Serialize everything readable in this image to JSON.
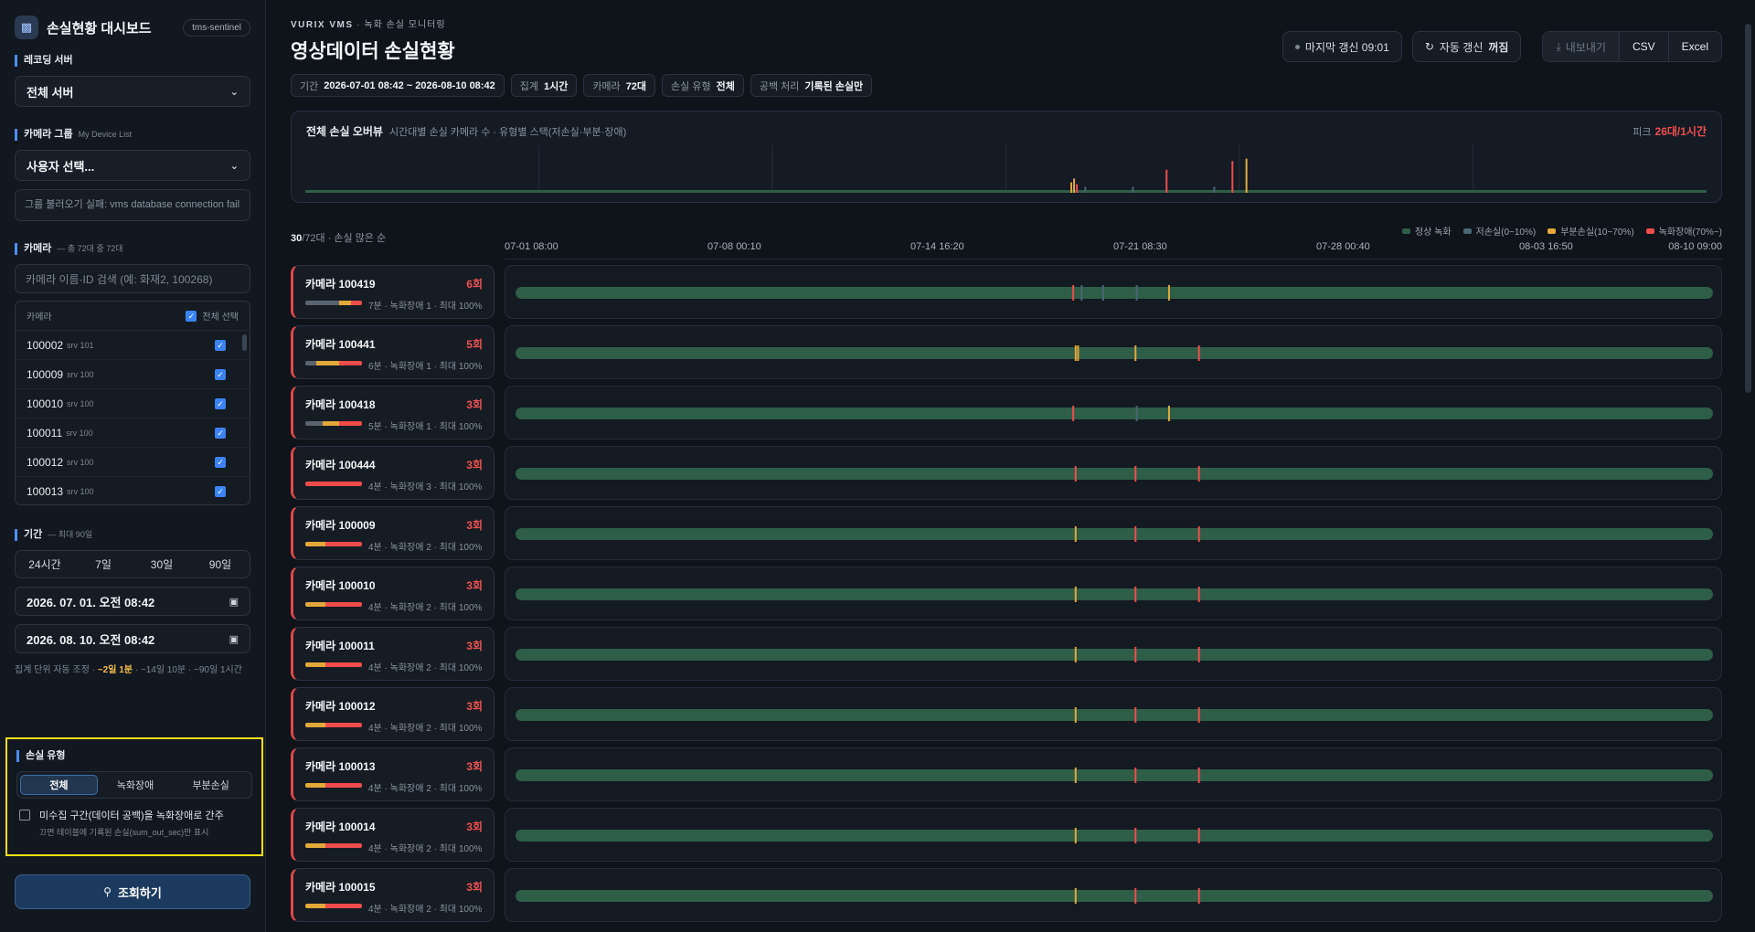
{
  "sidebar": {
    "brand_title": "손실현황 대시보드",
    "brand_tag": "tms-sentinel",
    "recording_server": {
      "label": "레코딩 서버",
      "selected": "전체 서버"
    },
    "camera_group": {
      "label": "카메라 그룹",
      "sublabel": "My Device List",
      "selected": "사용자 선택...",
      "error": "그룹 불러오기 실패: vms database connection fail"
    },
    "camera": {
      "label": "카메라",
      "sublabel": "— 총 72대 중 72대",
      "search_placeholder": "카메라 이름·ID 검색 (예: 화재2, 100268)",
      "list_header": "카메라",
      "select_all": "전체 선택",
      "items": [
        {
          "id": "100002",
          "server": "srv 101"
        },
        {
          "id": "100009",
          "server": "srv 100"
        },
        {
          "id": "100010",
          "server": "srv 100"
        },
        {
          "id": "100011",
          "server": "srv 100"
        },
        {
          "id": "100012",
          "server": "srv 100"
        },
        {
          "id": "100013",
          "server": "srv 100"
        }
      ]
    },
    "period": {
      "label": "기간",
      "sublabel": "— 최대 90일",
      "presets": [
        "24시간",
        "7일",
        "30일",
        "90일"
      ],
      "start": "2026. 07. 01. 오전 08:42",
      "end": "2026. 08. 10. 오전 08:42",
      "hint_pre": "집계 단위 자동 조정 · ",
      "hint_highlight": "~2일 1분",
      "hint_post": " · ~14일 10분 · ~90일 1시간"
    },
    "loss_type": {
      "label": "손실 유형",
      "options": [
        "전체",
        "녹화장애",
        "부분손실"
      ],
      "active": "전체",
      "checkbox_label": "미수집 구간(데이터 공백)을 녹화장애로 간주",
      "checkbox_sub": "끄면 테이블에 기록된 손실(sum_out_sec)만 표시"
    },
    "query_button": "조회하기"
  },
  "header": {
    "eyebrow_brand": "VURIX VMS",
    "eyebrow_rest": " · 녹화 손실 모니터링",
    "title": "영상데이터 손실현황",
    "last_update": "마지막 갱신 09:01",
    "auto_refresh_label": "자동 갱신",
    "auto_refresh_state": "꺼짐",
    "export_label": "내보내기",
    "csv_label": "CSV",
    "excel_label": "Excel"
  },
  "filters": [
    {
      "key": "기간",
      "value": "2026-07-01 08:42 ~ 2026-08-10 08:42"
    },
    {
      "key": "집계",
      "value": "1시간"
    },
    {
      "key": "카메라",
      "value": "72대"
    },
    {
      "key": "손실 유형",
      "value": "전체"
    },
    {
      "key": "공백 처리",
      "value": "기록된 손실만"
    }
  ],
  "overview": {
    "title": "전체 손실 오버뷰",
    "subtitle": "시간대별 손실 카메라 수 · 유형별 스택(저손실·부분·장애)",
    "peak_label": "피크",
    "peak_value": "26대/1시간",
    "spikes": [
      {
        "t": 0.546,
        "level": 0.14,
        "type": "partial"
      },
      {
        "t": 0.548,
        "level": 0.22,
        "type": "partial"
      },
      {
        "t": 0.55,
        "level": 0.1,
        "type": "outage"
      },
      {
        "t": 0.556,
        "level": 0.05,
        "type": "low"
      },
      {
        "t": 0.59,
        "level": 0.05,
        "type": "low"
      },
      {
        "t": 0.614,
        "level": 0.4,
        "type": "outage"
      },
      {
        "t": 0.648,
        "level": 0.05,
        "type": "low"
      },
      {
        "t": 0.661,
        "level": 0.58,
        "type": "outage"
      },
      {
        "t": 0.671,
        "level": 0.63,
        "type": "partial"
      }
    ]
  },
  "list": {
    "count": "30",
    "suffix": "/72대 · 손실 많은 순",
    "legend": [
      {
        "label": "정상 녹화",
        "color": "#2e5d48"
      },
      {
        "label": "저손실(0~10%)",
        "color": "#4a6672"
      },
      {
        "label": "부분손실(10~70%)",
        "color": "#e2a83a"
      },
      {
        "label": "녹화장애(70%~)",
        "color": "#ef4c4c"
      }
    ],
    "axis_ticks": [
      "07-01 08:00",
      "07-08 00:10",
      "07-14 16:20",
      "07-21 08:30",
      "07-28 00:40",
      "08-03 16:50",
      "08-10 09:00"
    ]
  },
  "cameras": [
    {
      "name": "카메라 100419",
      "count": "6회",
      "meta": "7분 · 녹화장애 1 · 최대 100%",
      "mini": [
        [
          "#5a6470",
          0.6
        ],
        [
          "#e2a83a",
          0.2
        ],
        [
          "#ef4c4c",
          0.2
        ]
      ],
      "marks": [
        {
          "t": 0.465,
          "c": "#ef4c4c"
        },
        {
          "t": 0.472,
          "c": "#4a6672"
        },
        {
          "t": 0.49,
          "c": "#4a6672"
        },
        {
          "t": 0.518,
          "c": "#4a6672"
        },
        {
          "t": 0.545,
          "c": "#e2a83a"
        }
      ]
    },
    {
      "name": "카메라 100441",
      "count": "5회",
      "meta": "6분 · 녹화장애 1 · 최대 100%",
      "mini": [
        [
          "#5a6470",
          0.2
        ],
        [
          "#e2a83a",
          0.4
        ],
        [
          "#ef4c4c",
          0.4
        ]
      ],
      "marks": [
        {
          "t": 0.467,
          "c": "#e2a83a"
        },
        {
          "t": 0.469,
          "c": "#e2a83a"
        },
        {
          "t": 0.517,
          "c": "#e2a83a"
        },
        {
          "t": 0.57,
          "c": "#ef4c4c"
        }
      ]
    },
    {
      "name": "카메라 100418",
      "count": "3회",
      "meta": "5분 · 녹화장애 1 · 최대 100%",
      "mini": [
        [
          "#5a6470",
          0.3
        ],
        [
          "#e2a83a",
          0.3
        ],
        [
          "#ef4c4c",
          0.4
        ]
      ],
      "marks": [
        {
          "t": 0.465,
          "c": "#ef4c4c"
        },
        {
          "t": 0.518,
          "c": "#4a6672"
        },
        {
          "t": 0.545,
          "c": "#e2a83a"
        }
      ]
    },
    {
      "name": "카메라 100444",
      "count": "3회",
      "meta": "4분 · 녹화장애 3 · 최대 100%",
      "mini": [
        [
          "#ef4c4c",
          1
        ]
      ],
      "marks": [
        {
          "t": 0.467,
          "c": "#ef4c4c"
        },
        {
          "t": 0.517,
          "c": "#ef4c4c"
        },
        {
          "t": 0.57,
          "c": "#ef4c4c"
        }
      ]
    },
    {
      "name": "카메라 100009",
      "count": "3회",
      "meta": "4분 · 녹화장애 2 · 최대 100%",
      "mini": [
        [
          "#e2a83a",
          0.35
        ],
        [
          "#ef4c4c",
          0.65
        ]
      ],
      "marks": [
        {
          "t": 0.467,
          "c": "#e2a83a"
        },
        {
          "t": 0.517,
          "c": "#ef4c4c"
        },
        {
          "t": 0.57,
          "c": "#ef4c4c"
        }
      ]
    },
    {
      "name": "카메라 100010",
      "count": "3회",
      "meta": "4분 · 녹화장애 2 · 최대 100%",
      "mini": [
        [
          "#e2a83a",
          0.35
        ],
        [
          "#ef4c4c",
          0.65
        ]
      ],
      "marks": [
        {
          "t": 0.467,
          "c": "#e2a83a"
        },
        {
          "t": 0.517,
          "c": "#ef4c4c"
        },
        {
          "t": 0.57,
          "c": "#ef4c4c"
        }
      ]
    },
    {
      "name": "카메라 100011",
      "count": "3회",
      "meta": "4분 · 녹화장애 2 · 최대 100%",
      "mini": [
        [
          "#e2a83a",
          0.35
        ],
        [
          "#ef4c4c",
          0.65
        ]
      ],
      "marks": [
        {
          "t": 0.467,
          "c": "#e2a83a"
        },
        {
          "t": 0.517,
          "c": "#ef4c4c"
        },
        {
          "t": 0.57,
          "c": "#ef4c4c"
        }
      ]
    },
    {
      "name": "카메라 100012",
      "count": "3회",
      "meta": "4분 · 녹화장애 2 · 최대 100%",
      "mini": [
        [
          "#e2a83a",
          0.35
        ],
        [
          "#ef4c4c",
          0.65
        ]
      ],
      "marks": [
        {
          "t": 0.467,
          "c": "#e2a83a"
        },
        {
          "t": 0.517,
          "c": "#ef4c4c"
        },
        {
          "t": 0.57,
          "c": "#ef4c4c"
        }
      ]
    },
    {
      "name": "카메라 100013",
      "count": "3회",
      "meta": "4분 · 녹화장애 2 · 최대 100%",
      "mini": [
        [
          "#e2a83a",
          0.35
        ],
        [
          "#ef4c4c",
          0.65
        ]
      ],
      "marks": [
        {
          "t": 0.467,
          "c": "#e2a83a"
        },
        {
          "t": 0.517,
          "c": "#ef4c4c"
        },
        {
          "t": 0.57,
          "c": "#ef4c4c"
        }
      ]
    },
    {
      "name": "카메라 100014",
      "count": "3회",
      "meta": "4분 · 녹화장애 2 · 최대 100%",
      "mini": [
        [
          "#e2a83a",
          0.35
        ],
        [
          "#ef4c4c",
          0.65
        ]
      ],
      "marks": [
        {
          "t": 0.467,
          "c": "#e2a83a"
        },
        {
          "t": 0.517,
          "c": "#ef4c4c"
        },
        {
          "t": 0.57,
          "c": "#ef4c4c"
        }
      ]
    },
    {
      "name": "카메라 100015",
      "count": "3회",
      "meta": "4분 · 녹화장애 2 · 최대 100%",
      "mini": [
        [
          "#e2a83a",
          0.35
        ],
        [
          "#ef4c4c",
          0.65
        ]
      ],
      "marks": [
        {
          "t": 0.467,
          "c": "#e2a83a"
        },
        {
          "t": 0.517,
          "c": "#ef4c4c"
        },
        {
          "t": 0.57,
          "c": "#ef4c4c"
        }
      ]
    }
  ]
}
